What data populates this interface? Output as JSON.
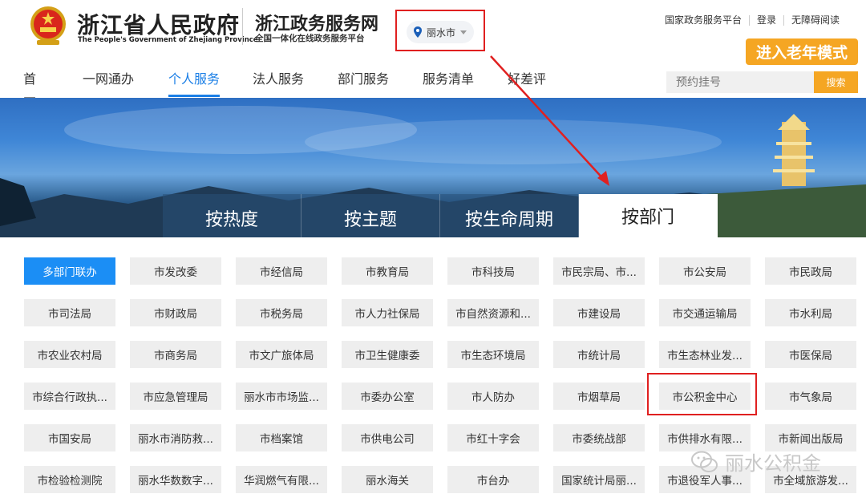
{
  "header": {
    "site_title": "浙江省人民政府",
    "site_subtitle": "The People's Government of Zhejiang Province",
    "portal_title": "浙江政务服务网",
    "portal_subtitle": "全国一体化在线政务服务平台",
    "city": "丽水市",
    "top_links": [
      "国家政务服务平台",
      "登录",
      "无障碍阅读"
    ],
    "elder_mode": "进入老年模式"
  },
  "nav": {
    "items": [
      "首页",
      "一网通办",
      "个人服务",
      "法人服务",
      "部门服务",
      "服务清单",
      "好差评"
    ],
    "active_index": 2
  },
  "search": {
    "placeholder": "预约挂号",
    "button": "搜索"
  },
  "tabs": {
    "items": [
      "按热度",
      "按主题",
      "按生命周期",
      "按部门"
    ],
    "active_index": 3
  },
  "departments": [
    "多部门联办",
    "市发改委",
    "市经信局",
    "市教育局",
    "市科技局",
    "市民宗局、市...",
    "市公安局",
    "市民政局",
    "市司法局",
    "市财政局",
    "市税务局",
    "市人力社保局",
    "市自然资源和...",
    "市建设局",
    "市交通运输局",
    "市水利局",
    "市农业农村局",
    "市商务局",
    "市文广旅体局",
    "市卫生健康委",
    "市生态环境局",
    "市统计局",
    "市生态林业发...",
    "市医保局",
    "市综合行政执...",
    "市应急管理局",
    "丽水市市场监...",
    "市委办公室",
    "市人防办",
    "市烟草局",
    "市公积金中心",
    "市气象局",
    "市国安局",
    "丽水市消防救...",
    "市档案馆",
    "市供电公司",
    "市红十字会",
    "市委统战部",
    "市供排水有限...",
    "市新闻出版局",
    "市检验检测院",
    "丽水华数数字...",
    "华润燃气有限...",
    "丽水海关",
    "市台办",
    "国家统计局丽...",
    "市退役军人事...",
    "市全域旅游发..."
  ],
  "selected_department": "多部门联办",
  "highlighted_department": "市公积金中心",
  "watermark": "丽水公积金",
  "colors": {
    "accent": "#1b7fe6",
    "orange": "#f5a623",
    "annotation_red": "#e02020"
  }
}
